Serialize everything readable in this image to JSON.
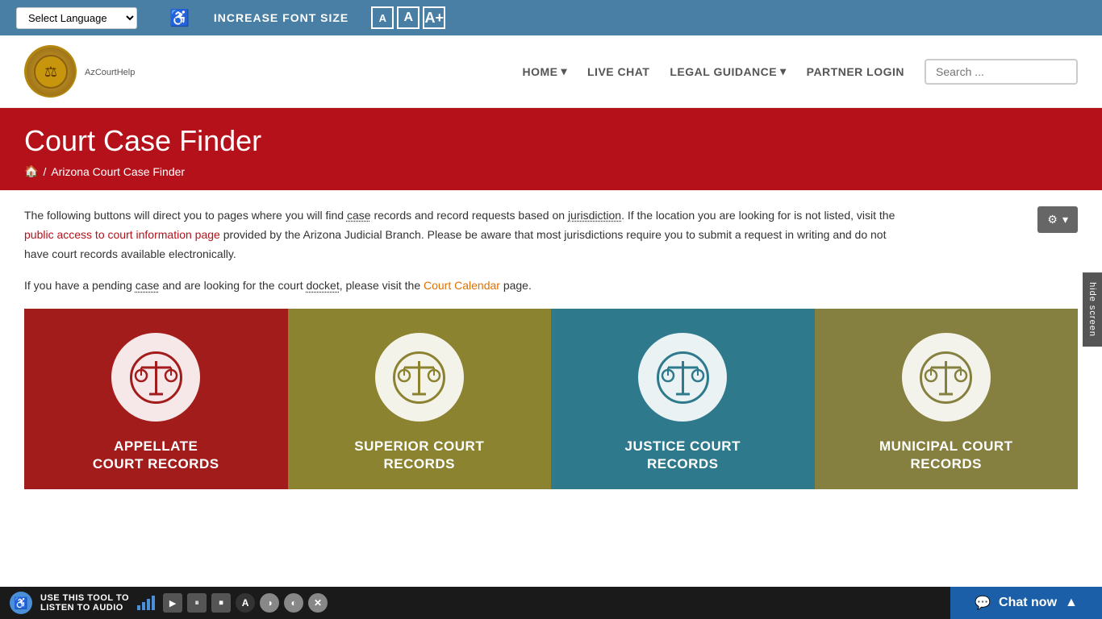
{
  "topbar": {
    "language_select_label": "Select Language",
    "accessibility_icon": "♿",
    "font_size_label": "INCREASE FONT SIZE",
    "font_btn_small": "A",
    "font_btn_medium": "A",
    "font_btn_large": "A+"
  },
  "header": {
    "logo_text": "AzCourtHelp",
    "logo_emoji": "⚖",
    "nav": {
      "home": "HOME",
      "live_chat": "LIVE CHAT",
      "legal_guidance": "LEGAL GUIDANCE",
      "partner_login": "PARTNER LOGIN"
    },
    "search_placeholder": "Search ..."
  },
  "hero": {
    "title": "Court Case Finder",
    "breadcrumb_home": "🏠",
    "breadcrumb_separator": "/",
    "breadcrumb_current": "Arizona Court Case Finder"
  },
  "main": {
    "gear_icon": "⚙",
    "dropdown_icon": "▾",
    "paragraph1": "The following buttons will direct you to pages where you will find case records and record requests based on jurisdiction.  If the location you are looking for is not listed, visit the public access to court information page provided by the Arizona Judicial Branch.  Please be aware that most jurisdictions require you to submit a request in writing and do not have court records available electronically.",
    "paragraph1_link_text": "public access to court information page",
    "paragraph2_start": "If you have a pending case and are looking for the court docket, please visit the ",
    "paragraph2_link": "Court Calendar",
    "paragraph2_end": " page.",
    "cards": [
      {
        "id": "appellate",
        "title": "APPELLATE\nCOURT RECORDS",
        "bg_color": "#a31c1c",
        "icon_color": "#a31c1c"
      },
      {
        "id": "superior",
        "title": "SUPERIOR COURT\nRECORDS",
        "bg_color": "#8b8330",
        "icon_color": "#8b8330"
      },
      {
        "id": "justice",
        "title": "JUSTICE COURT\nRECORDS",
        "bg_color": "#2e7a8c",
        "icon_color": "#2e7a8c"
      },
      {
        "id": "municipal",
        "title": "MUNICIPAL COURT\nRECORDS",
        "bg_color": "#858040",
        "icon_color": "#858040"
      }
    ]
  },
  "bottombar": {
    "listen_text": "USE THIS TOOL TO\nLISTEN TO AUDIO",
    "controls": [
      "▶",
      "⏸",
      "⏹",
      "A",
      "◑",
      "◐",
      "⊗"
    ]
  },
  "chat": {
    "label": "Chat now",
    "chevron_up": "▲"
  },
  "hide_screen": {
    "label": "hide screen"
  }
}
